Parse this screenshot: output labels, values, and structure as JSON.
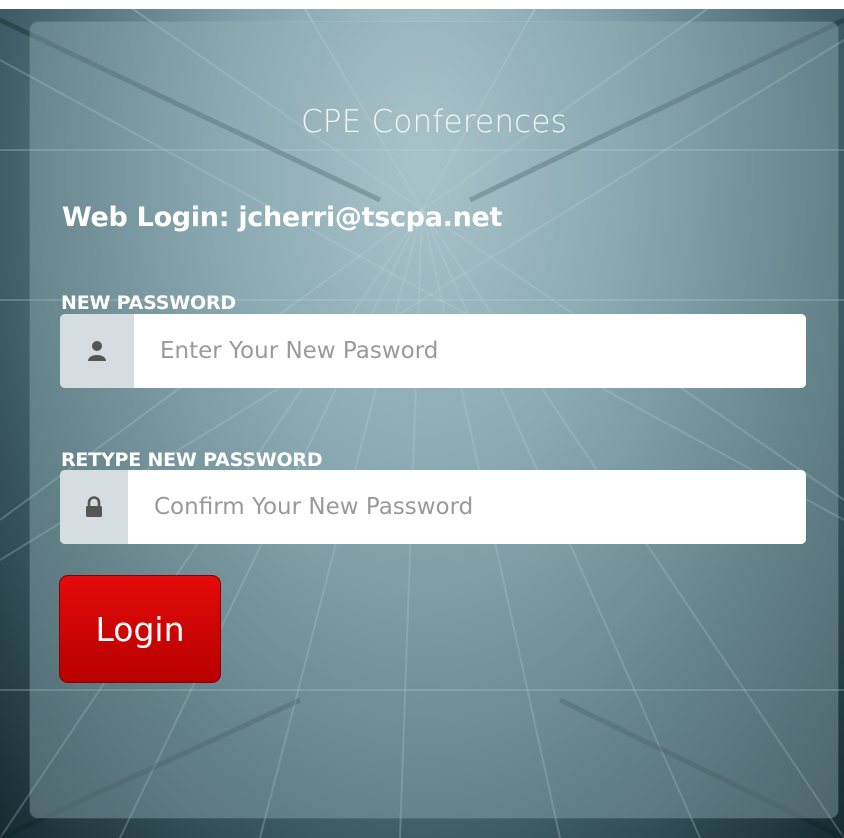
{
  "app": {
    "title": "CPE Conferences"
  },
  "login": {
    "web_login_text": "Web Login: jcherri@tscpa.net"
  },
  "fields": {
    "new_password": {
      "label": "NEW PASSWORD",
      "placeholder": "Enter Your New Pasword",
      "value": "",
      "icon": "user-icon"
    },
    "retype_password": {
      "label": "RETYPE NEW PASSWORD",
      "placeholder": "Confirm Your New Password",
      "value": "",
      "icon": "lock-icon"
    }
  },
  "actions": {
    "login_label": "Login"
  },
  "colors": {
    "button": "#cc0000",
    "addon": "#d6dde0"
  }
}
